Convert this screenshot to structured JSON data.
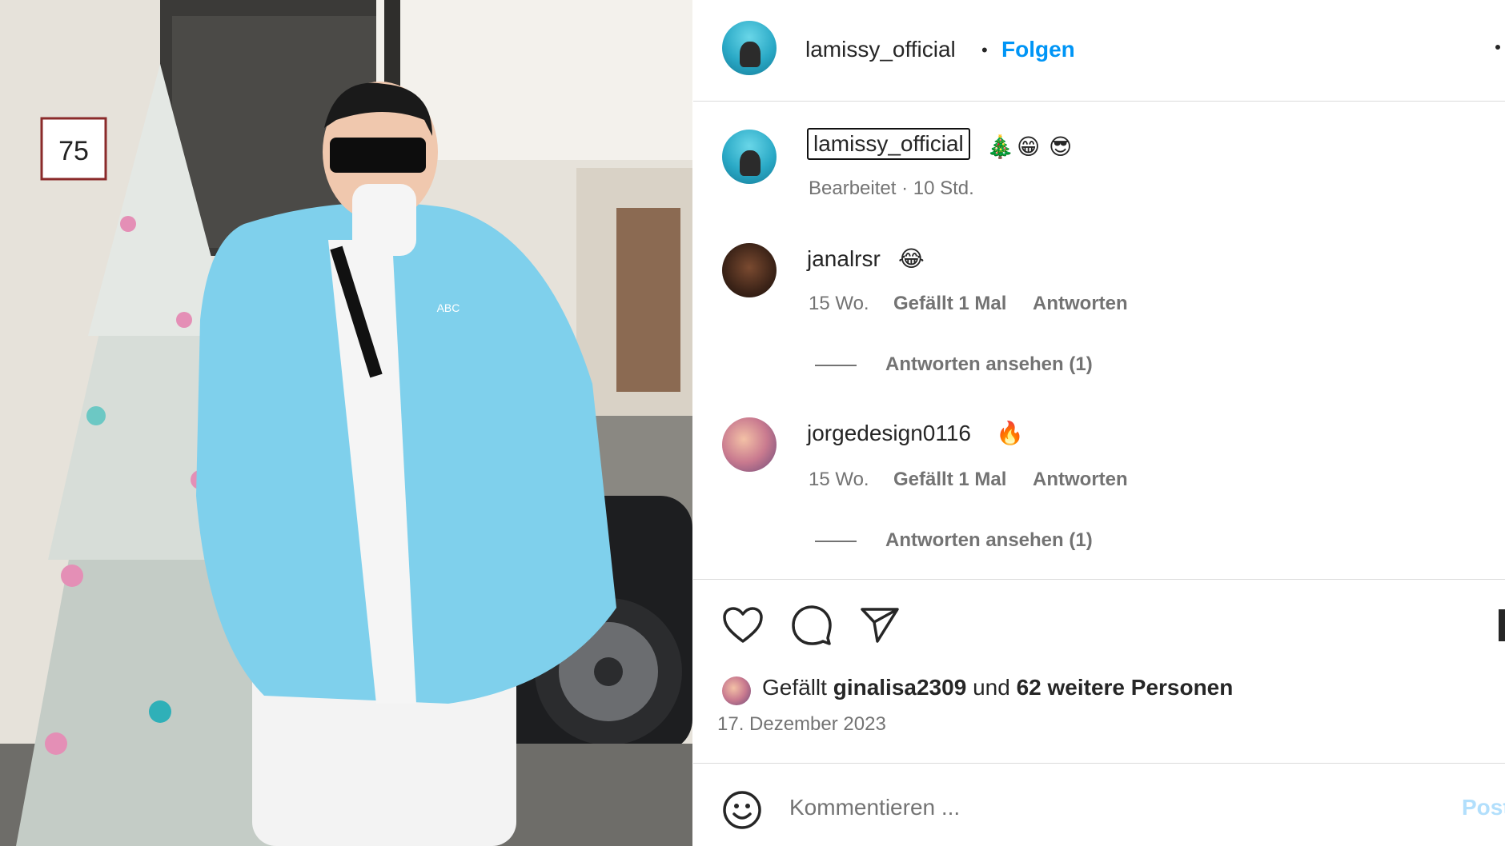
{
  "header": {
    "username": "lamissy_official",
    "separator": "•",
    "follow_label": "Folgen",
    "more_icon": "more-dots-icon"
  },
  "caption": {
    "username": "lamissy_official",
    "emojis": [
      "🎄",
      "😁",
      "😎"
    ],
    "meta": "Bearbeitet · 10 Std."
  },
  "comments": [
    {
      "username": "janalrsr",
      "emoji": "😂",
      "time": "15 Wo.",
      "likes": "Gefällt 1 Mal",
      "reply": "Antworten",
      "view_replies": "Antworten ansehen (1)"
    },
    {
      "username": "jorgedesign0116",
      "emoji": "🔥",
      "time": "15 Wo.",
      "likes": "Gefällt 1 Mal",
      "reply": "Antworten",
      "view_replies": "Antworten ansehen (1)"
    }
  ],
  "actions": {
    "like_icon": "heart-icon",
    "comment_icon": "comment-bubble-icon",
    "share_icon": "paper-plane-icon",
    "save_icon": "bookmark-icon"
  },
  "likes": {
    "prefix": "Gefällt",
    "user": "ginalisa2309",
    "joiner": "und",
    "others": "62 weitere Personen"
  },
  "date": "17. Dezember 2023",
  "comment_box": {
    "emoji_icon": "smiley-icon",
    "placeholder": "Kommentieren ...",
    "post_label": "Posten"
  },
  "photo": {
    "house_number": "75",
    "jacket_text": "ABC"
  },
  "colors": {
    "accent": "#0095f6",
    "muted": "#737373",
    "divider": "#dbdbdb",
    "jacket": "#7fd0ec"
  }
}
